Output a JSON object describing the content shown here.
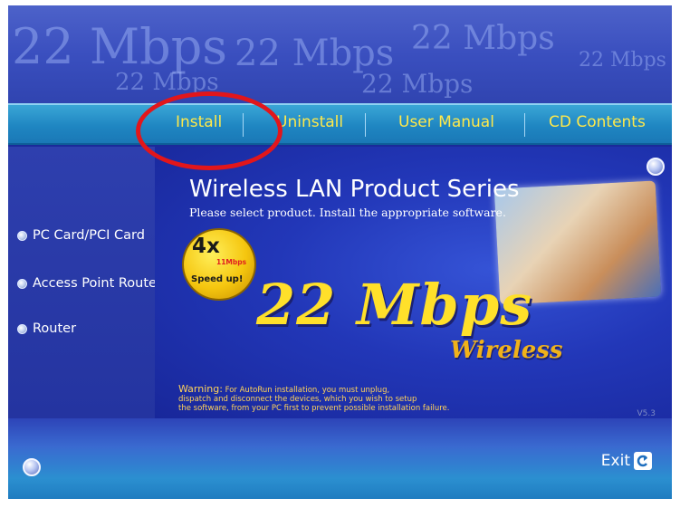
{
  "banner": {
    "background_text": "22 Mbps"
  },
  "menu": {
    "items": [
      {
        "label": "Install"
      },
      {
        "label": "Uninstall"
      },
      {
        "label": "User Manual"
      },
      {
        "label": "CD Contents"
      }
    ]
  },
  "sidebar": {
    "items": [
      {
        "label": "PC Card/PCI Card"
      },
      {
        "label": "Access Point Router"
      },
      {
        "label": "Router"
      }
    ]
  },
  "main": {
    "title": "Wireless LAN Product Series",
    "subtitle": "Please select product. Install the appropriate software.",
    "badge": {
      "big": "4x",
      "small": "11Mbps",
      "caption": "Speed up!"
    },
    "hero": "22 Mbps",
    "hero_sub": "Wireless",
    "warning": {
      "label": "Warning:",
      "line1": " For AutoRun installation, you must unplug,",
      "line2": "dispatch and disconnect the devices, which you wish to setup",
      "line3": "the software, from your PC first to prevent possible installation failure."
    },
    "version": "V5.3"
  },
  "footer": {
    "exit_label": "Exit"
  },
  "colors": {
    "menu_text": "#ffe94a",
    "annotation": "#e2161b",
    "hero": "#ffe02a",
    "warning_text": "#ffd35a"
  },
  "icons": {
    "exit": "exit-arrow-icon",
    "side_bullet": "radio-bullet-icon",
    "round_button": "round-button-icon"
  }
}
